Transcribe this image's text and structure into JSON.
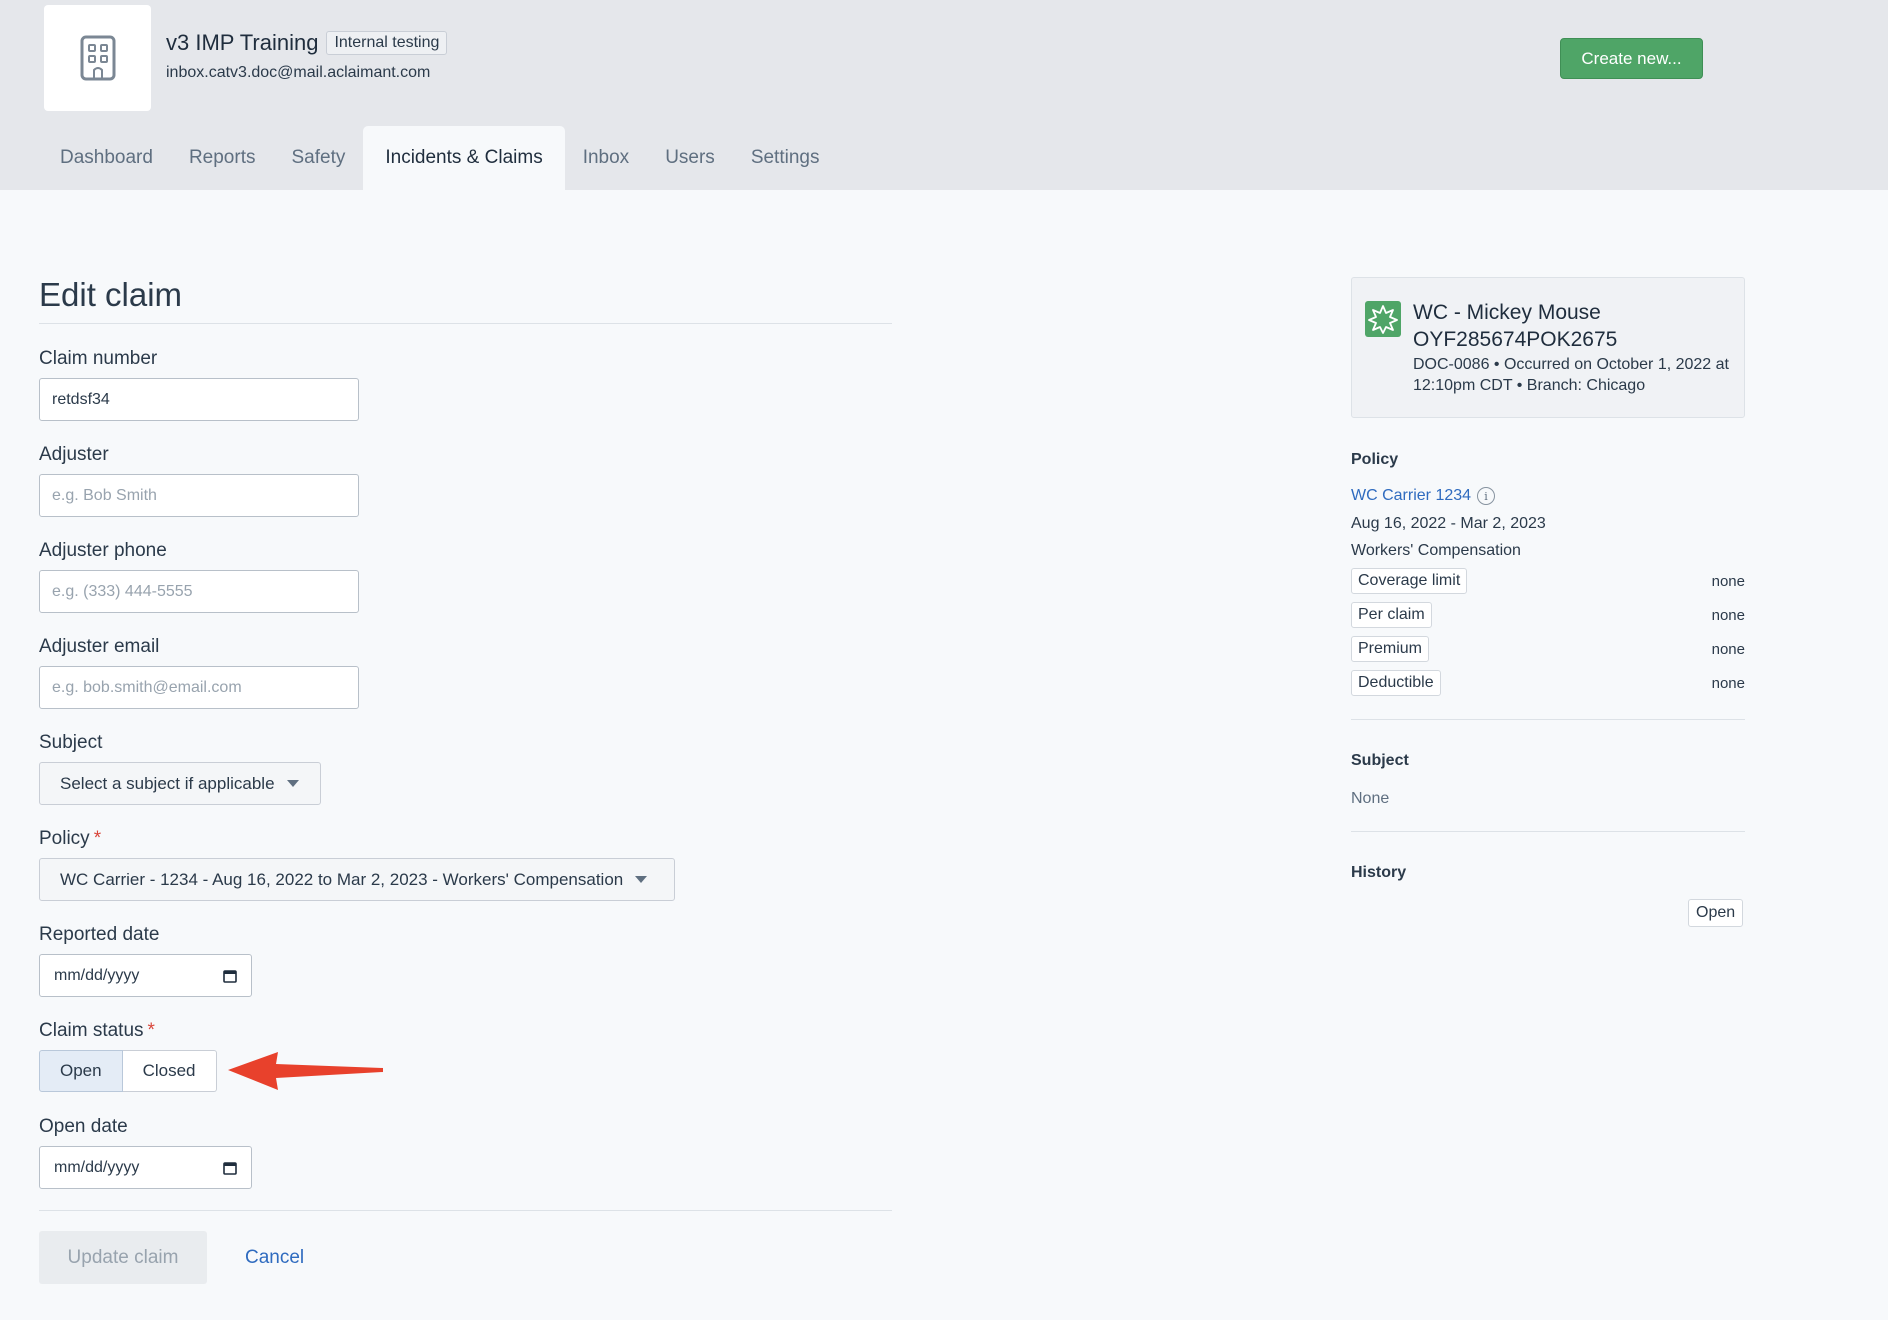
{
  "header": {
    "org_name": "v3 IMP Training",
    "org_badge": "Internal testing",
    "org_email": "inbox.catv3.doc@mail.aclaimant.com",
    "create_button": "Create new...",
    "logo_icon": "building-icon",
    "create_button_color": "#4fa567"
  },
  "nav": {
    "tabs": [
      "Dashboard",
      "Reports",
      "Safety",
      "Incidents & Claims",
      "Inbox",
      "Users",
      "Settings"
    ],
    "active_tab": "Incidents & Claims"
  },
  "form": {
    "title": "Edit claim",
    "claim_number": {
      "label": "Claim number",
      "value": "retdsf34"
    },
    "adjuster": {
      "label": "Adjuster",
      "placeholder": "e.g. Bob Smith"
    },
    "adjuster_phone": {
      "label": "Adjuster phone",
      "placeholder": "e.g. (333) 444-5555"
    },
    "adjuster_email": {
      "label": "Adjuster email",
      "placeholder": "e.g. bob.smith@email.com"
    },
    "subject": {
      "label": "Subject",
      "selected": "Select a subject if applicable"
    },
    "policy": {
      "label": "Policy",
      "required_mark": "*",
      "selected": "WC Carrier - 1234 - Aug 16, 2022 to Mar 2, 2023 - Workers' Compensation"
    },
    "reported_date": {
      "label": "Reported date",
      "placeholder": "mm/dd/yyyy"
    },
    "claim_status": {
      "label": "Claim status",
      "required_mark": "*",
      "options": [
        "Open",
        "Closed"
      ],
      "selected": "Open"
    },
    "open_date": {
      "label": "Open date",
      "placeholder": "mm/dd/yyyy"
    },
    "update_button": "Update claim",
    "cancel_link": "Cancel"
  },
  "sidebar": {
    "claim": {
      "title": "WC - Mickey Mouse",
      "claim_id": "OYF285674POK2675",
      "meta": "DOC-0086  •  Occurred on October 1, 2022 at 12:10pm CDT  •  Branch: Chicago",
      "icon": "starburst-icon"
    },
    "policy": {
      "heading": "Policy",
      "link": "WC Carrier 1234",
      "dates": "Aug 16, 2022 - Mar 2, 2023",
      "type": "Workers' Compensation",
      "coverage": [
        {
          "label": "Coverage limit",
          "value": "none"
        },
        {
          "label": "Per claim",
          "value": "none"
        },
        {
          "label": "Premium",
          "value": "none"
        },
        {
          "label": "Deductible",
          "value": "none"
        }
      ]
    },
    "subject": {
      "heading": "Subject",
      "value": "None"
    },
    "history": {
      "heading": "History",
      "badge": "Open"
    }
  },
  "accent_colors": {
    "link": "#2f6bbf",
    "required": "#d9463a",
    "annotation_arrow": "#e8412c"
  }
}
